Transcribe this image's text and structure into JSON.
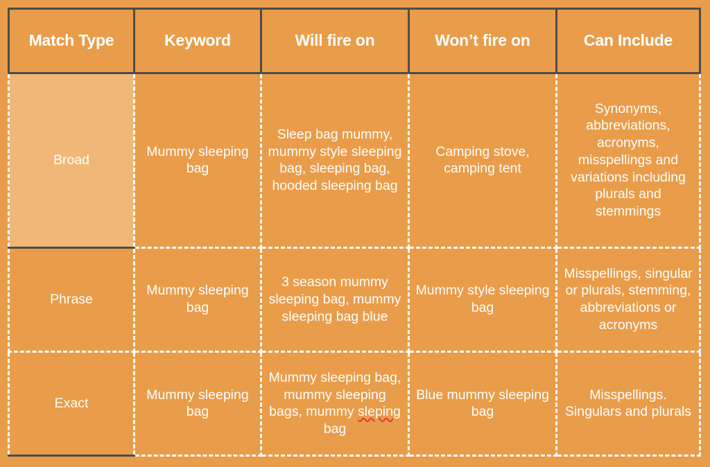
{
  "colors": {
    "page_background": "#e99c49",
    "cell_background": "#e99c49",
    "highlight_cell": "#efb877",
    "solid_border": "#4c4c4c",
    "dashed_border": "#ffffff",
    "header_text": "#ffffff",
    "body_text": "#ffffff",
    "match_type_text": "#2b2b2b",
    "spellcheck_underline": "#e03a3a"
  },
  "table": {
    "headers": [
      "Match Type",
      "Keyword",
      "Will fire on",
      "Won’t fire on",
      "Can Include"
    ],
    "rows": [
      {
        "match_type": "Broad",
        "keyword": "Mummy sleeping bag",
        "will_fire_on": "Sleep bag mummy, mummy style sleeping bag, sleeping bag, hooded sleeping bag",
        "wont_fire_on": "Camping stove, camping tent",
        "can_include": "Synonyms, abbreviations, acronyms, misspellings and variations including plurals and stemmings"
      },
      {
        "match_type": "Phrase",
        "keyword": "Mummy sleeping bag",
        "will_fire_on": "3 season mummy sleeping bag, mummy sleeping bag blue",
        "wont_fire_on": "Mummy style sleeping bag",
        "can_include": "Misspellings, singular or plurals, stemming, abbreviations or acronyms"
      },
      {
        "match_type": "Exact",
        "keyword": "Mummy sleeping bag",
        "will_fire_on_parts": {
          "before": "Mummy sleeping bag, mummy sleeping bags, mummy ",
          "misspelled": "sleping",
          "after": " bag"
        },
        "will_fire_on": "Mummy sleeping bag, mummy sleeping bags, mummy sleping bag",
        "wont_fire_on": "Blue mummy sleeping bag",
        "can_include": "Misspellings. Singulars and plurals"
      }
    ]
  }
}
